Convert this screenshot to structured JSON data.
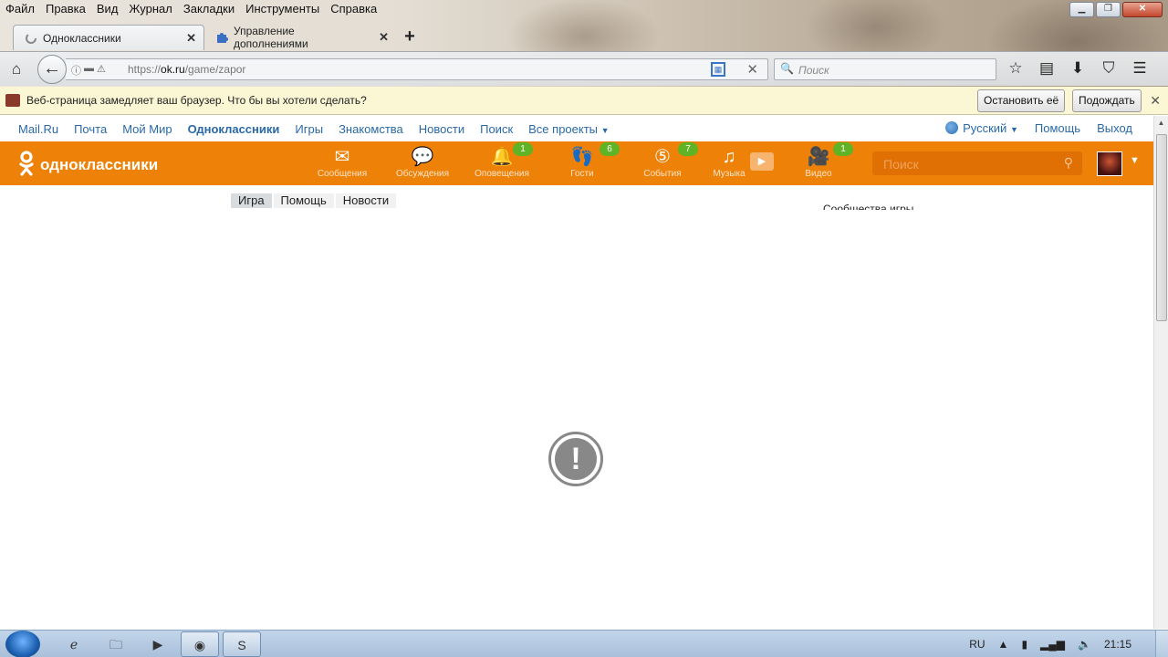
{
  "menu": [
    "Файл",
    "Правка",
    "Вид",
    "Журнал",
    "Закладки",
    "Инструменты",
    "Справка"
  ],
  "window_controls": {
    "minimize_icon": "minimize-icon",
    "restore_icon": "restore-icon",
    "close_icon": "close-icon"
  },
  "tabs": [
    {
      "title": "Одноклассники",
      "icon": "loading-icon"
    },
    {
      "title": "Управление дополнениями",
      "icon": "puzzle-icon"
    }
  ],
  "navbar": {
    "url_prefix": "https://",
    "url_host": "ok.ru",
    "url_path": "/game/zapor",
    "search_placeholder": "Поиск"
  },
  "notification": {
    "text": "Веб-страница замедляет ваш браузер. Что бы вы хотели сделать?",
    "stop_label": "Остановить её",
    "wait_label": "Подождать"
  },
  "portal": {
    "links": [
      "Mail.Ru",
      "Почта",
      "Мой Мир",
      "Одноклассники",
      "Игры",
      "Знакомства",
      "Новости",
      "Поиск",
      "Все проекты"
    ],
    "current": "Одноклассники",
    "language": "Русский",
    "help": "Помощь",
    "logout": "Выход"
  },
  "ok": {
    "logo_text": "одноклассники",
    "brand_color": "#ee8208",
    "nav": [
      {
        "label": "Сообщения",
        "icon": "envelope-icon",
        "badge": ""
      },
      {
        "label": "Обсуждения",
        "icon": "chat-bubbles-icon",
        "badge": ""
      },
      {
        "label": "Оповещения",
        "icon": "bell-icon",
        "badge": "1"
      },
      {
        "label": "Гости",
        "icon": "footprints-icon",
        "badge": "6"
      },
      {
        "label": "События",
        "icon": "events-five-icon",
        "badge": "7"
      },
      {
        "label": "Музыка",
        "icon": "music-note-icon",
        "badge": ""
      },
      {
        "label": "Видео",
        "icon": "video-camera-icon",
        "badge": "1"
      }
    ],
    "search_placeholder": "Поиск"
  },
  "game": {
    "tabs": [
      "Игра",
      "Помощь",
      "Новости"
    ],
    "active_tab": "Игра",
    "community_label": "Сообщества игры"
  },
  "taskbar": {
    "lang": "RU",
    "clock": "21:15"
  }
}
